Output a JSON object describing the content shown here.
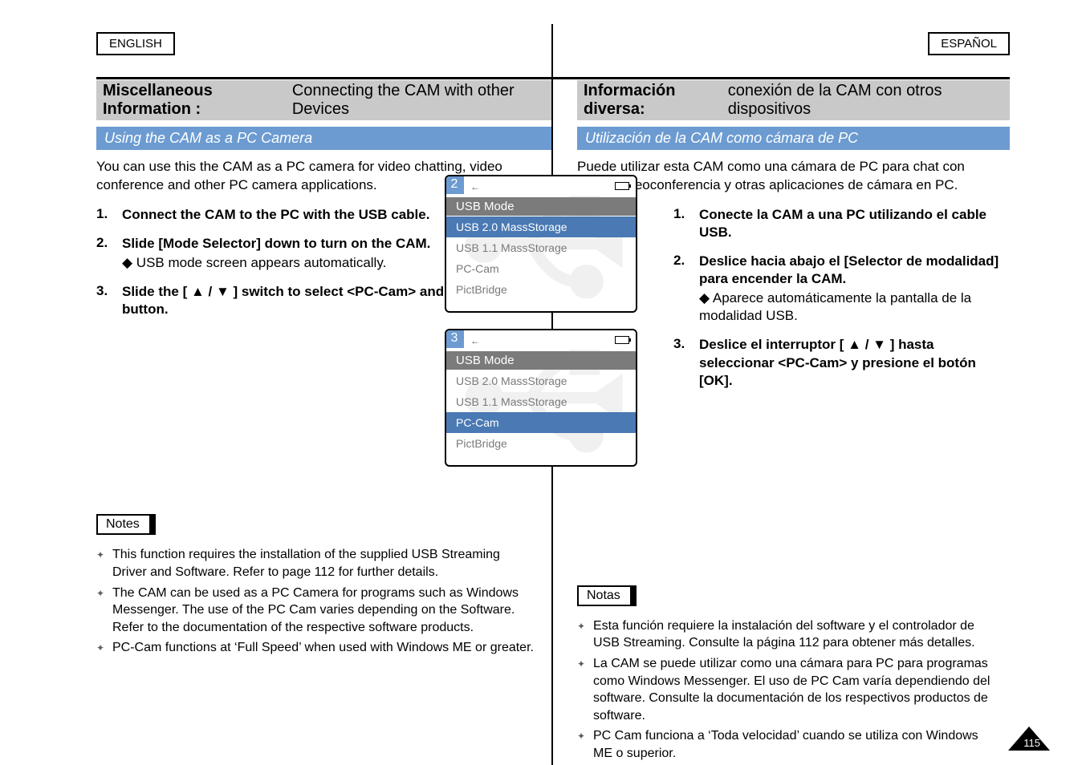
{
  "lang_left": "ENGLISH",
  "lang_right": "ESPAÑOL",
  "left": {
    "header_main": "Miscellaneous Information :",
    "header_sub": "Connecting the CAM with other Devices",
    "blue": "Using the CAM as a PC Camera",
    "intro": "You can use this the CAM as a PC camera for video chatting, video conference and other PC camera applications.",
    "steps": [
      {
        "n": "1.",
        "bold": "Connect the CAM to the PC with the USB cable."
      },
      {
        "n": "2.",
        "bold": "Slide [Mode Selector] down to turn on the CAM.",
        "sub": "◆ USB mode screen appears automatically."
      },
      {
        "n": "3.",
        "bold": "Slide the [ ▲ / ▼ ] switch to select <PC-Cam> and press the [OK] button."
      }
    ],
    "notes_label": "Notes",
    "notes": [
      "This function requires the installation of the supplied USB Streaming Driver and Software. Refer to page 112 for further details.",
      "The CAM can be used as a PC Camera for programs such as Windows Messenger. The use of the PC Cam varies depending on the Software. Refer to the documentation of the respective software products.",
      "PC-Cam functions at ‘Full Speed’ when used with Windows ME or greater."
    ]
  },
  "right": {
    "header_main": "Información diversa:",
    "header_sub": "conexión de la CAM con otros dispositivos",
    "blue": "Utilización de la CAM como cámara de PC",
    "intro": "Puede utilizar esta CAM como una cámara de PC para chat con video, videoconferencia y otras aplicaciones de cámara en PC.",
    "steps": [
      {
        "n": "1.",
        "bold": "Conecte la CAM a una PC utilizando el cable USB."
      },
      {
        "n": "2.",
        "bold": "Deslice hacia abajo el [Selector de modalidad] para encender la CAM.",
        "sub": "◆ Aparece automáticamente la pantalla de la modalidad USB."
      },
      {
        "n": "3.",
        "bold": "Deslice el interruptor [ ▲ / ▼ ] hasta seleccionar <PC-Cam>  y presione el botón [OK]."
      }
    ],
    "notes_label": "Notas",
    "notes": [
      "Esta función requiere la instalación del software y el controlador de USB Streaming. Consulte la página 112 para obtener más detalles.",
      "La CAM se puede utilizar como una cámara para PC para programas como Windows Messenger. El uso de PC Cam varía dependiendo del software. Consulte la documentación de los respectivos productos de software.",
      "PC Cam funciona a ‘Toda velocidad’ cuando se utiliza con Windows ME o superior."
    ]
  },
  "screens": {
    "s2": {
      "num": "2",
      "title": "USB Mode",
      "items": [
        "USB 2.0 MassStorage",
        "USB 1.1 MassStorage",
        "PC-Cam",
        "PictBridge"
      ],
      "sel": 0
    },
    "s3": {
      "num": "3",
      "title": "USB Mode",
      "items": [
        "USB 2.0 MassStorage",
        "USB 1.1 MassStorage",
        "PC-Cam",
        "PictBridge"
      ],
      "sel": 2
    }
  },
  "page_number": "115"
}
